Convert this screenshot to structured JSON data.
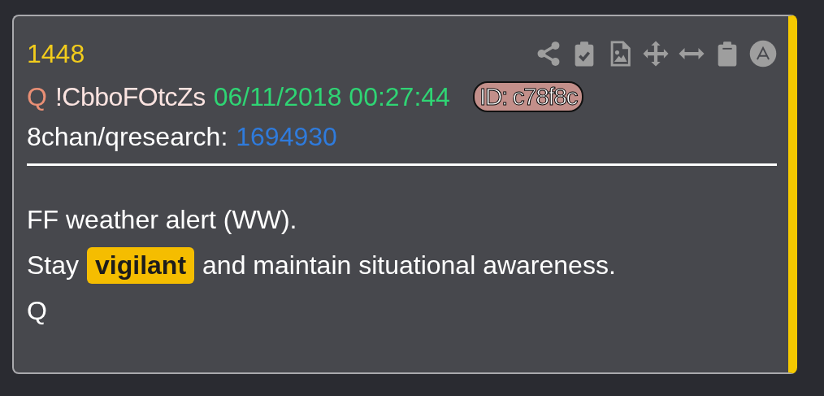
{
  "post": {
    "number": "1448",
    "author": {
      "name": "Q",
      "tripcode": "!CbboFOtcZs",
      "datetime": "06/11/2018 00:27:44",
      "id": "ID: c78f8c"
    },
    "source": {
      "board": "8chan/qresearch:",
      "post_number": "1694930"
    },
    "lines": [
      [
        {
          "kind": "plain",
          "text": "FF weather alert (WW)."
        }
      ],
      [
        {
          "kind": "plain",
          "text": "Stay"
        },
        {
          "kind": "highlight",
          "text": "vigilant"
        },
        {
          "kind": "plain",
          "text": "and maintain situational awareness."
        }
      ],
      [
        {
          "kind": "plain",
          "text": "Q"
        }
      ]
    ]
  }
}
